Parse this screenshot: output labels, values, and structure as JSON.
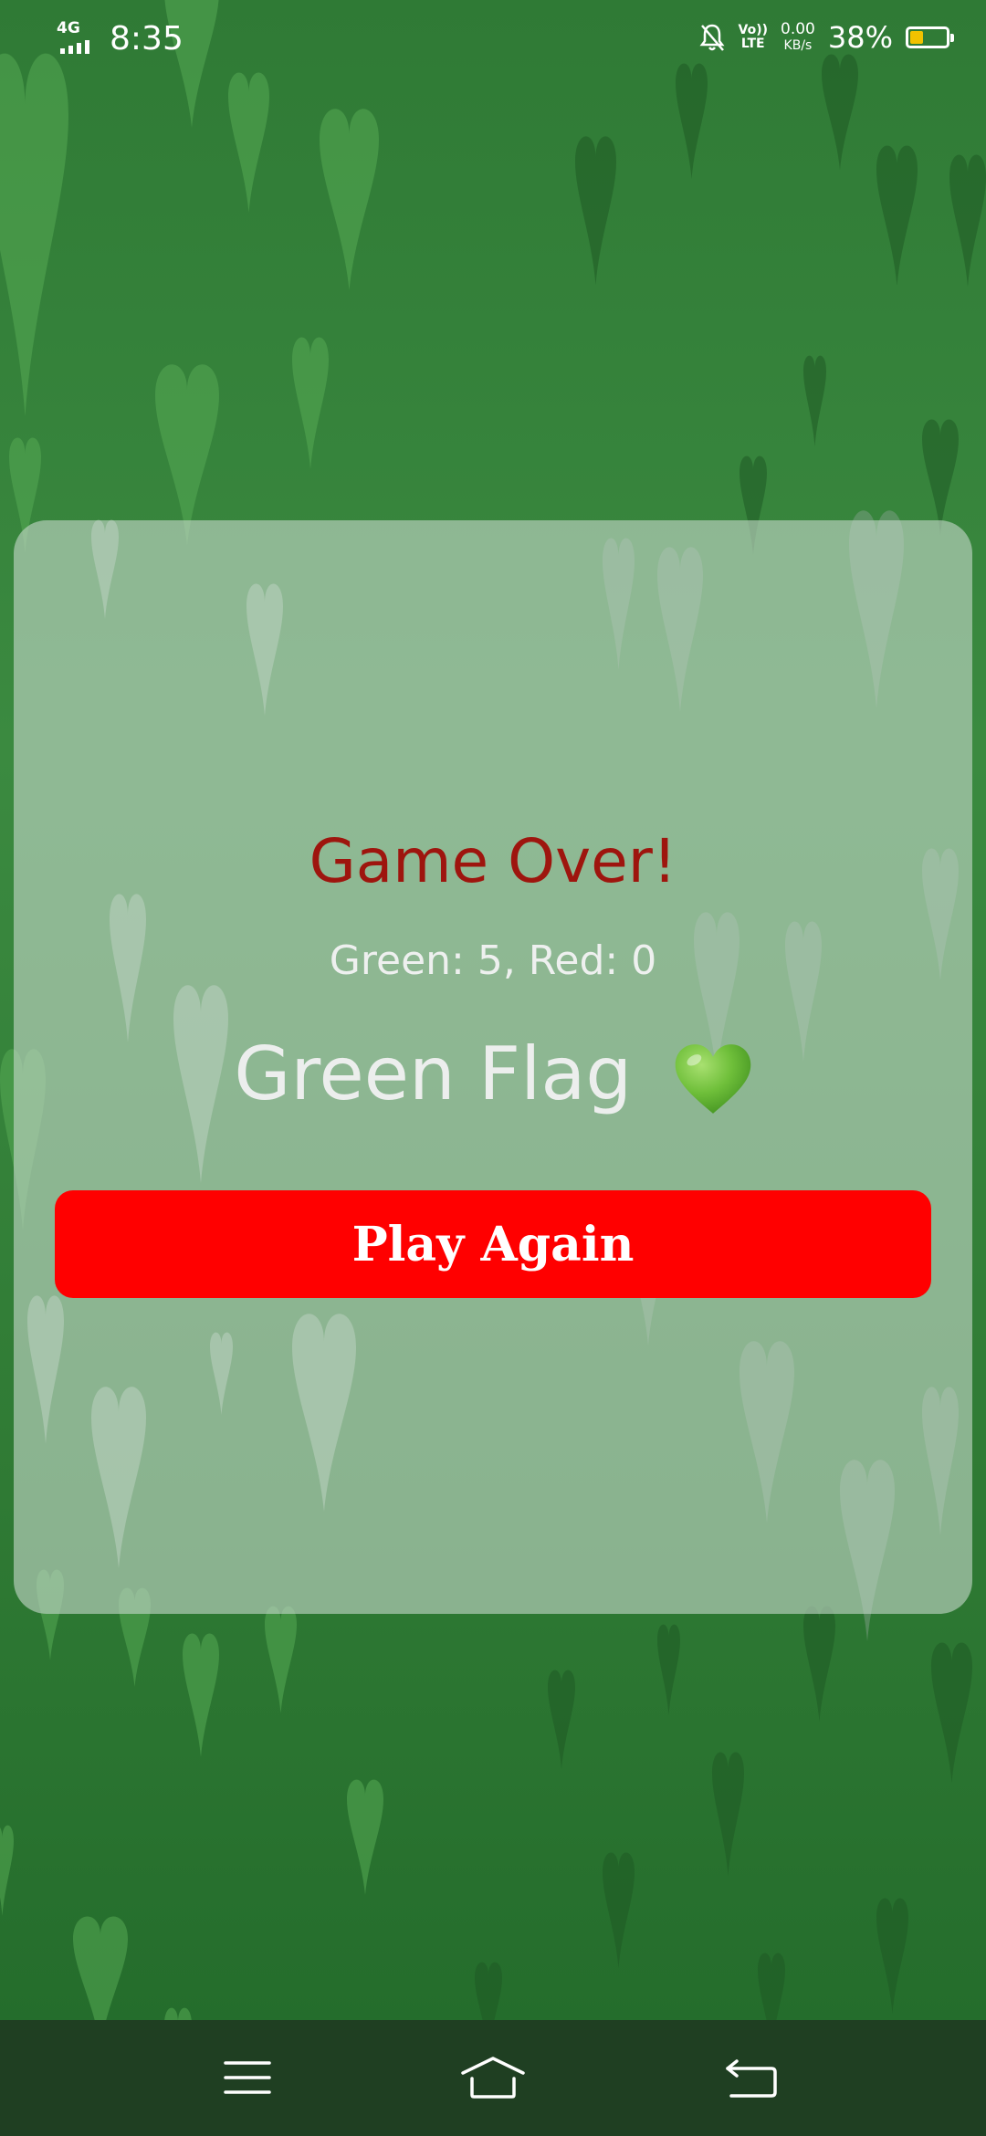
{
  "status_bar": {
    "network": "4G",
    "time": "8:35",
    "volte_top": "Vo))",
    "volte_bottom": "LTE",
    "speed_value": "0.00",
    "speed_unit": "KB/s",
    "battery_percent": "38%",
    "battery_level": 0.38,
    "icons": [
      "signal-icon",
      "notifications-muted-icon",
      "volte-icon",
      "battery-icon"
    ]
  },
  "game_over": {
    "title": "Game Over!",
    "score": "Green: 5, Red: 0",
    "verdict": "Green Flag",
    "verdict_icon": "green-heart-icon",
    "play_again_label": "Play Again"
  },
  "nav_bar": {
    "icons": [
      "menu-icon",
      "home-icon",
      "back-icon"
    ]
  },
  "colors": {
    "background": "#2f7a35",
    "title": "#9e150e",
    "button": "#ff0000",
    "heart": "#6fbf3a",
    "nav_bar": "#1f3f22"
  }
}
